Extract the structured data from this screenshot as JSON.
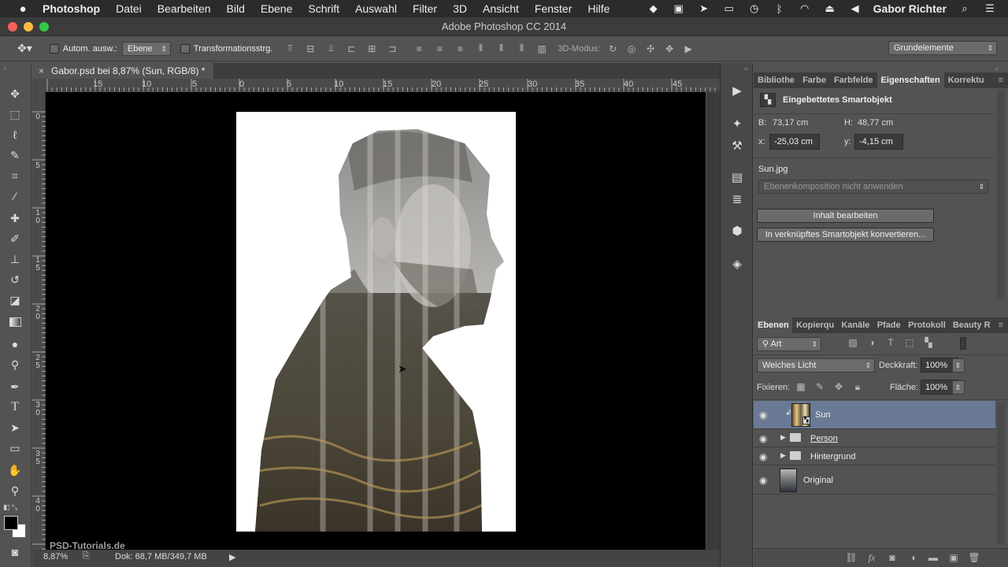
{
  "menubar": {
    "app": "Photoshop",
    "items": [
      "Datei",
      "Bearbeiten",
      "Bild",
      "Ebene",
      "Schrift",
      "Auswahl",
      "Filter",
      "3D",
      "Ansicht",
      "Fenster",
      "Hilfe"
    ],
    "user": "Gabor Richter"
  },
  "window": {
    "title": "Adobe Photoshop CC 2014"
  },
  "options": {
    "auto_select_label": "Autom. ausw.:",
    "auto_select_value": "Ebene",
    "transform_label": "Transformationsstrg.",
    "mode3d_label": "3D-Modus:",
    "workspace": "Grundelemente"
  },
  "document": {
    "tab_title": "Gabor.psd bei 8,87% (Sun, RGB/8) *",
    "ruler_h": [
      "15",
      "10",
      "5",
      "0",
      "5",
      "10",
      "15",
      "20",
      "25",
      "30",
      "35",
      "40",
      "45"
    ],
    "ruler_v": [
      "0",
      "5",
      "1\n0",
      "1\n5",
      "2\n0",
      "2\n5",
      "3\n0",
      "3\n5",
      "4\n0"
    ],
    "zoom": "8,87%",
    "doc_info": "Dok: 68,7 MB/349,7 MB",
    "watermark": "PSD-Tutorials.de"
  },
  "properties": {
    "tabs": [
      "Bibliothe",
      "Farbe",
      "Farbfelde",
      "Eigenschaften",
      "Korrektu"
    ],
    "active_tab": 3,
    "header": "Eingebettetes Smartobjekt",
    "w_label": "B:",
    "w_value": "73,17 cm",
    "h_label": "H:",
    "h_value": "48,77 cm",
    "x_label": "x:",
    "x_value": "-25,03 cm",
    "y_label": "y:",
    "y_value": "-4,15 cm",
    "file": "Sun.jpg",
    "comp_placeholder": "Ebenenkomposition nicht anwenden",
    "edit_button": "Inhalt bearbeiten",
    "convert_button": "In verknüpftes Smartobjekt konvertieren..."
  },
  "layers": {
    "tabs": [
      "Ebenen",
      "Kopierqu",
      "Kanäle",
      "Pfade",
      "Protokoll",
      "Beauty R"
    ],
    "active_tab": 0,
    "filter": "Art",
    "blend_mode": "Weiches Licht",
    "opacity_label": "Deckkraft:",
    "opacity_value": "100%",
    "lock_label": "Fixieren:",
    "fill_label": "Fläche:",
    "fill_value": "100%",
    "items": [
      {
        "name": "Sun",
        "type": "smart",
        "selected": true
      },
      {
        "name": "Person",
        "type": "group",
        "selected": false
      },
      {
        "name": "Hintergrund",
        "type": "group",
        "selected": false
      },
      {
        "name": "Original",
        "type": "image",
        "selected": false
      }
    ]
  },
  "colors": {
    "selected_layer": "#6a7a95",
    "chrome_dark": "#2b2b2b",
    "panel": "#535353"
  }
}
